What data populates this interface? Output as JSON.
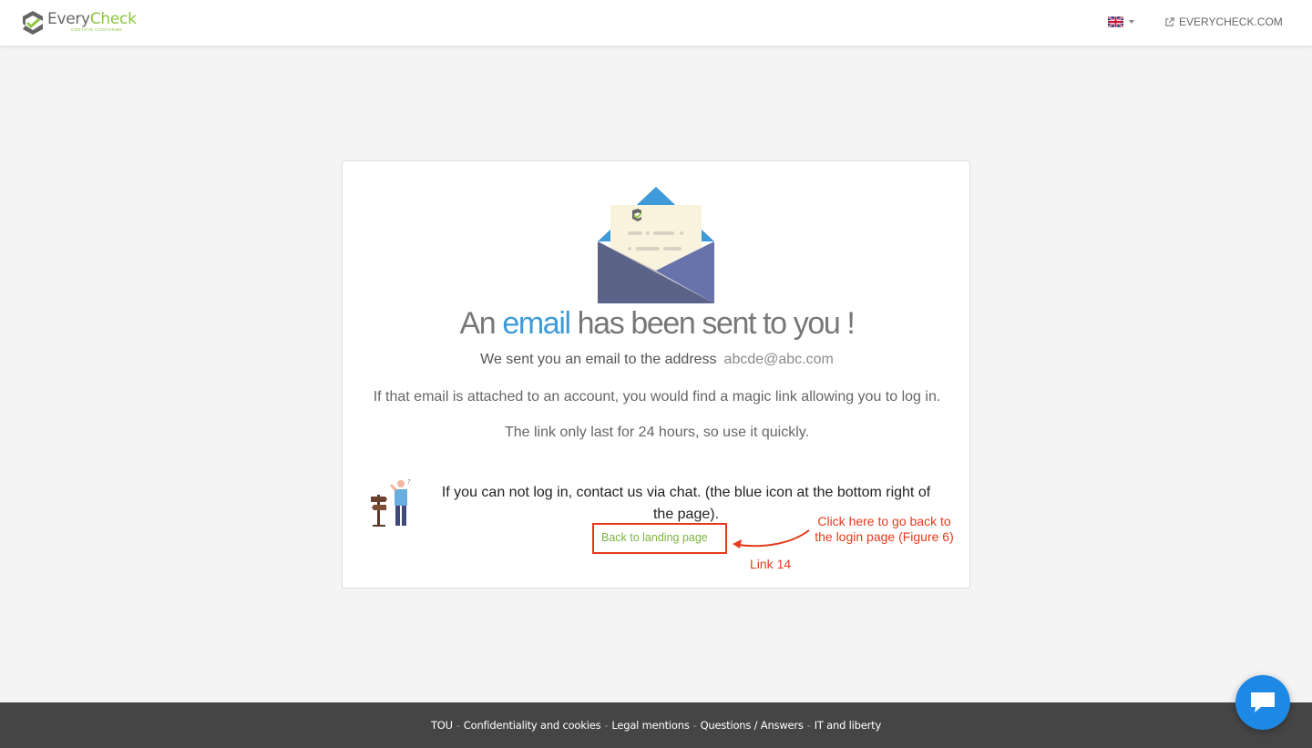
{
  "header": {
    "brand_every": "Every",
    "brand_check": "Check",
    "brand_tagline": "CERTIFIÉ CONFORME",
    "language_flag": "uk-flag-icon",
    "external_link_label": "EVERYCHECK.COM"
  },
  "card": {
    "headline_before": "An ",
    "headline_accent": "email",
    "headline_after": " has been sent to you !",
    "sent_text": "We sent you an email to the address",
    "email_address": "abcde@abc.com",
    "info_text": "If that email is attached to an account, you would find a magic link allowing you to log in.",
    "expiry_text": "The link only last for 24 hours, so use it quickly.",
    "help_text": "If you can not log in, contact us via chat. (the blue icon at the bottom right of the page).",
    "back_link_label": "Back to landing page"
  },
  "annotations": {
    "main_line1": "Click here to go back to",
    "main_line2": "the login page (Figure 6)",
    "link_label": "Link 14",
    "color": "#e53a1c"
  },
  "footer": {
    "links": [
      "TOU",
      "Confidentiality and cookies",
      "Legal mentions",
      "Questions / Answers",
      "IT and liberty"
    ],
    "separator": "-"
  },
  "chat": {
    "icon": "chat-bubble-icon"
  },
  "colors": {
    "brand_green": "#8cc63f",
    "accent_blue": "#3e9ad9",
    "footer_bg": "#454545",
    "chat_blue": "#1e88e5"
  }
}
